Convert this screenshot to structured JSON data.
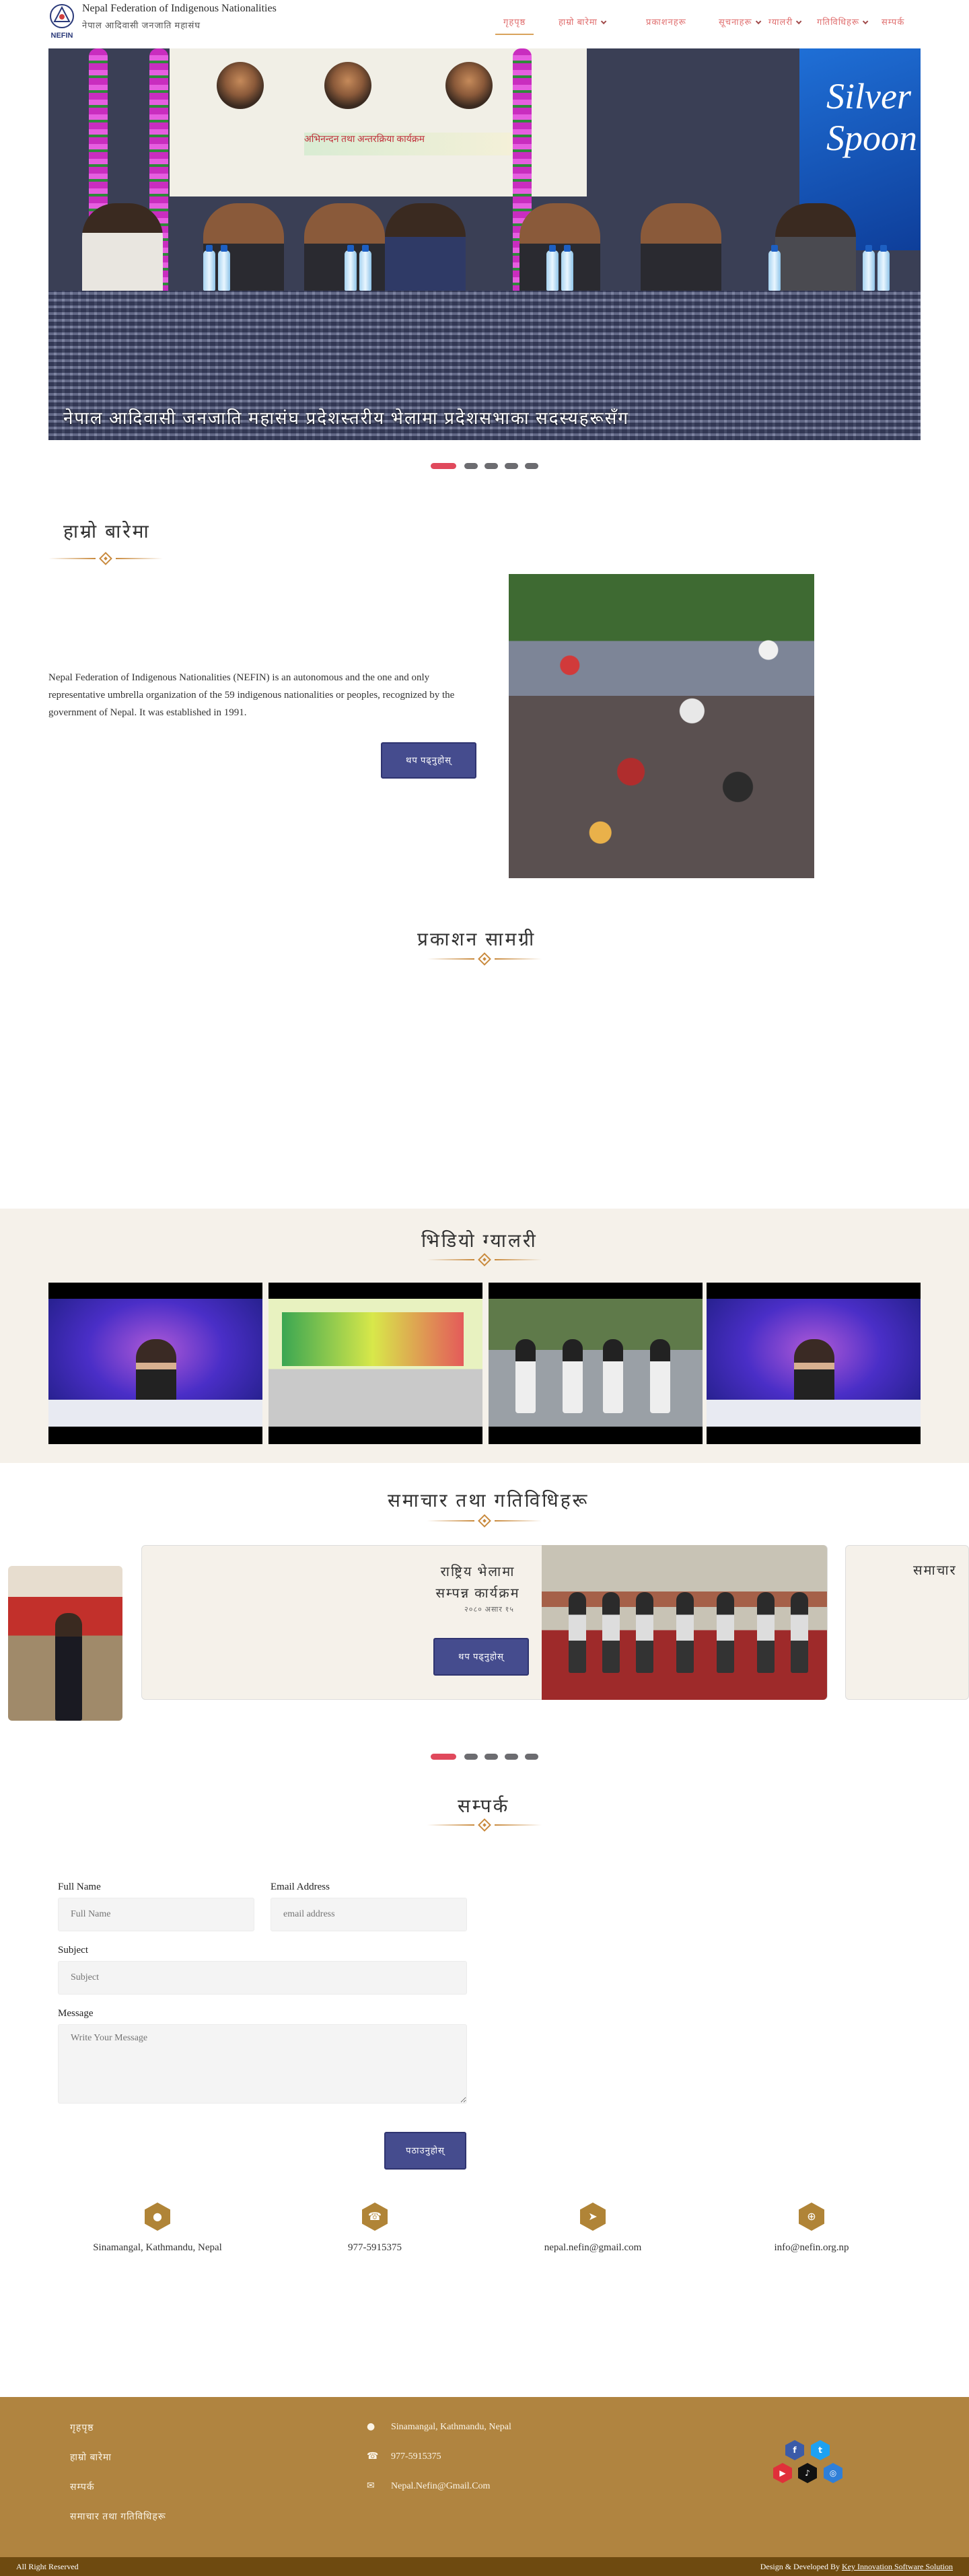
{
  "header": {
    "org_name_en": "Nepal Federation of Indigenous Nationalities",
    "org_name_np": "नेपाल आदिवासी जनजाति महासंघ",
    "logo_text": "NEFIN",
    "nav": [
      {
        "label": "गृहपृष्ठ",
        "active": true,
        "dropdown": false
      },
      {
        "label": "हाम्रो बारेमा",
        "active": false,
        "dropdown": true
      },
      {
        "label": "प्रकाशनहरू",
        "active": false,
        "dropdown": false
      },
      {
        "label": "सूचनाहरू",
        "active": false,
        "dropdown": true
      },
      {
        "label": "ग्यालरी",
        "active": false,
        "dropdown": true
      },
      {
        "label": "गतिविधिहरू",
        "active": false,
        "dropdown": true
      },
      {
        "label": "सम्पर्क",
        "active": false,
        "dropdown": false
      }
    ]
  },
  "hero": {
    "caption": "नेपाल आदिवासी जनजाति महासंघ प्रदेशस्तरीय भेलामा प्रदेशसभाका सदस्यहरूसँग",
    "banner_title": "अभिनन्दन तथा अन्तरक्रिया कार्यक्रम",
    "sign_text": "Silver Spoon",
    "slides": 5,
    "active_slide": 1
  },
  "about": {
    "title": "हाम्रो बारेमा",
    "body": "Nepal Federation of Indigenous Nationalities (NEFIN) is an autonomous and the one and only representative umbrella organization of the 59 indigenous nationalities or peoples, recognized by the government of Nepal. It was established in 1991.",
    "button": "थप पढ्नुहोस्"
  },
  "publications": {
    "title": "प्रकाशन सामग्री"
  },
  "video_gallery": {
    "title": "भिडियो ग्यालरी",
    "videos": [
      {
        "name": "news-video-1"
      },
      {
        "name": "event-video"
      },
      {
        "name": "dance-video"
      },
      {
        "name": "news-video-2"
      }
    ]
  },
  "news": {
    "title": "समाचार तथा गतिविधिहरू",
    "card_title": "राष्ट्रिय भेलामा सम्पन्न कार्यक्रम",
    "card_date": "२०८० असार १५",
    "button": "थप पढ्नुहोस्",
    "side_card_title": "समाचार",
    "slides": 5,
    "active_slide": 1
  },
  "contact": {
    "title": "सम्पर्क",
    "fields": {
      "full_name_label": "Full Name",
      "full_name_placeholder": "Full Name",
      "email_label": "Email Address",
      "email_placeholder": "email address",
      "subject_label": "Subject",
      "subject_placeholder": "Subject",
      "message_label": "Message",
      "message_placeholder": "Write Your Message"
    },
    "submit": "पठाउनुहोस्",
    "info": [
      {
        "icon": "location-icon",
        "text": "Sinamangal, Kathmandu, Nepal"
      },
      {
        "icon": "phone-icon",
        "text": "977-5915375"
      },
      {
        "icon": "send-icon",
        "text": "nepal.nefin@gmail.com"
      },
      {
        "icon": "globe-icon",
        "text": "info@nefin.org.np"
      }
    ]
  },
  "footer": {
    "links": [
      "गृहपृष्ठ",
      "हाम्रो बारेमा",
      "सम्पर्क",
      "समाचार तथा गतिविधिहरू"
    ],
    "address": "Sinamangal, Kathmandu, Nepal",
    "phone": "977-5915375",
    "email": "Nepal.Nefin@Gmail.Com",
    "social": [
      "facebook-icon",
      "twitter-icon",
      "youtube-icon",
      "tiktok-icon",
      "instagram-icon"
    ],
    "rights": "All Right Reserved",
    "credit_prefix": "Design & Developed By",
    "credit_link": "Key Innovation Software Solution"
  },
  "colors": {
    "accent_gold": "#b08437",
    "button_indigo": "#454c8e",
    "nav_text": "#e07070",
    "slider_active": "#e0495c",
    "footer_bg": "#b08440",
    "bottom_bar": "#6e4a10"
  }
}
